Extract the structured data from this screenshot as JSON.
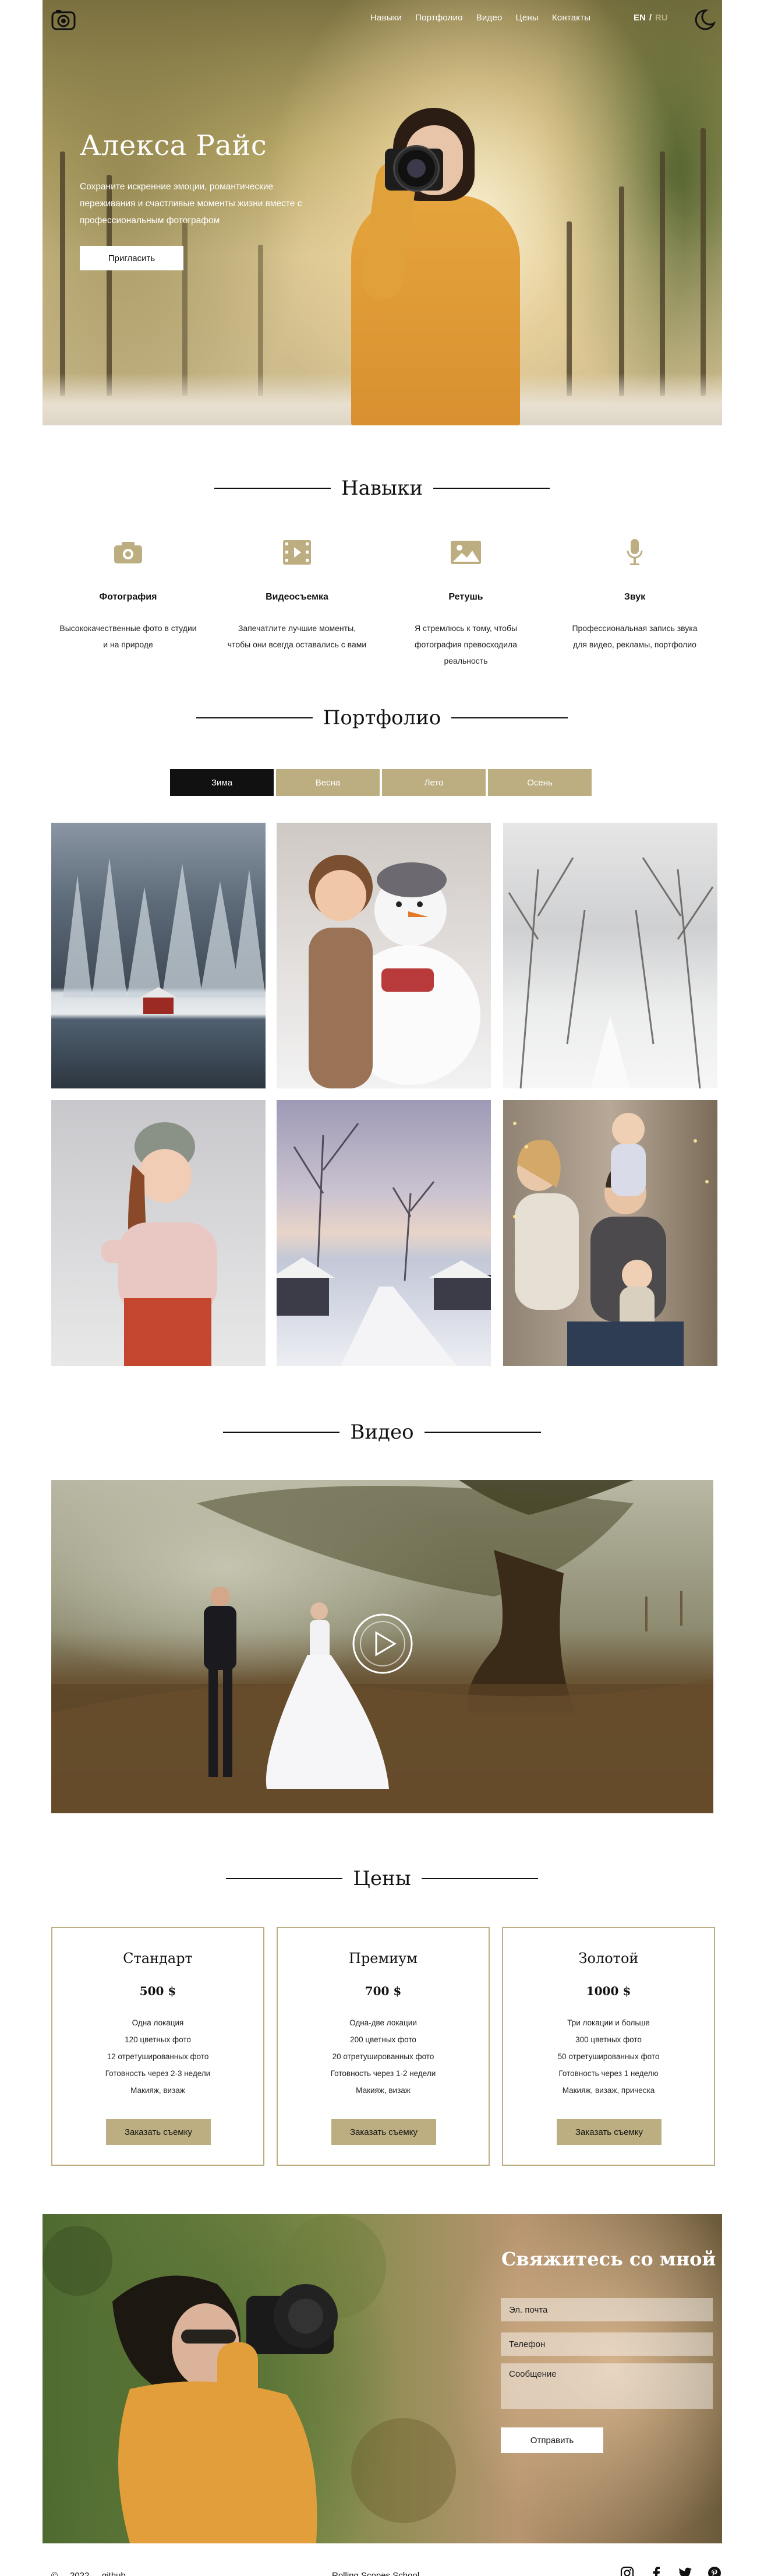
{
  "nav": {
    "items": [
      "Навыки",
      "Портфолио",
      "Видео",
      "Цены",
      "Контакты"
    ],
    "lang_en": "EN",
    "lang_sep": "/",
    "lang_ru": "RU"
  },
  "hero": {
    "title": "Алекса Райс",
    "text": "Сохраните искренние эмоции, романтические переживания и счастливые моменты жизни вместе с профессиональным фотографом",
    "button": "Пригласить"
  },
  "skills": {
    "title": "Навыки",
    "items": [
      {
        "icon": "camera-icon",
        "title": "Фотография",
        "text": "Высококачественные фото в студии и на природе"
      },
      {
        "icon": "video-icon",
        "title": "Видеосъемка",
        "text": "Запечатлите лучшие моменты, чтобы они всегда оставались с вами"
      },
      {
        "icon": "image-icon",
        "title": "Ретушь",
        "text": "Я стремлюсь к тому, чтобы фотография превосходила реальность"
      },
      {
        "icon": "microphone-icon",
        "title": "Звук",
        "text": "Профессиональная запись звука для видео, рекламы, портфолио"
      }
    ]
  },
  "portfolio": {
    "title": "Портфолио",
    "tabs": [
      "Зима",
      "Весна",
      "Лето",
      "Осень"
    ],
    "active_tab": 0
  },
  "video": {
    "title": "Видео"
  },
  "prices": {
    "title": "Цены",
    "plans": [
      {
        "name": "Стандарт",
        "price": "500 $",
        "features": [
          "Одна локация",
          "120 цветных фото",
          "12 отретушированных фото",
          "Готовность через 2-3 недели",
          "Макияж, визаж"
        ],
        "button": "Заказать съемку"
      },
      {
        "name": "Премиум",
        "price": "700 $",
        "features": [
          "Одна-две локации",
          "200 цветных фото",
          "20 отретушированных фото",
          "Готовность через 1-2 недели",
          "Макияж, визаж"
        ],
        "button": "Заказать съемку"
      },
      {
        "name": "Золотой",
        "price": "1000 $",
        "features": [
          "Три локации и больше",
          "300 цветных фото",
          "50 отретушированных фото",
          "Готовность через 1 неделю",
          "Макияж, визаж, прическа"
        ],
        "button": "Заказать съемку"
      }
    ]
  },
  "contacts": {
    "title": "Свяжитесь со мной",
    "email_placeholder": "Эл. почта",
    "phone_placeholder": "Телефон",
    "message_placeholder": "Сообщение",
    "send_button": "Отправить"
  },
  "footer": {
    "copyright": "©",
    "year": "2022",
    "github": "github",
    "school": "Rolling Scopes School",
    "social": [
      "instagram-icon",
      "facebook-icon",
      "twitter-icon",
      "pinterest-icon"
    ]
  },
  "colors": {
    "accent": "#bdae82",
    "dark": "#111111"
  }
}
